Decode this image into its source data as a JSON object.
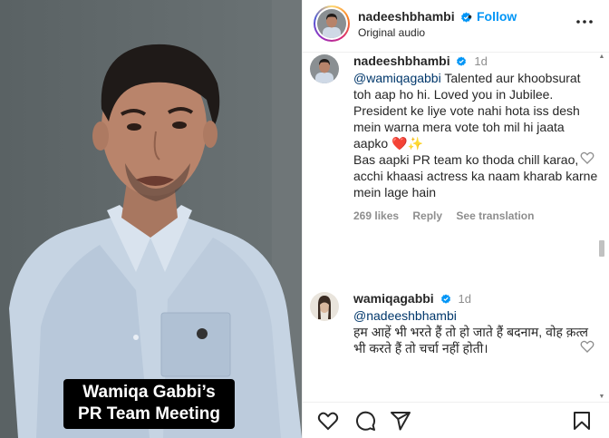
{
  "video": {
    "caption_line1": "Wamiqa Gabbi’s",
    "caption_line2": "PR Team Meeting"
  },
  "header": {
    "username": "nadeeshbhambi",
    "separator": "•",
    "follow_label": "Follow",
    "audio_label": "Original audio"
  },
  "comments": [
    {
      "username": "nadeeshbhambi",
      "time": "1d",
      "mention": "@wamiqagabbi",
      "text": "Talented aur khoobsurat toh aap ho hi. Loved you in Jubilee. President ke liye vote nahi hota iss desh mein warna mera vote toh mil hi jaata aapko",
      "emoji": "❤️✨",
      "text2": "Bas aapki PR team ko thoda chill karao, acchi khaasi actress ka naam kharab karne mein lage hain",
      "likes": "269 likes",
      "reply_label": "Reply",
      "translate_label": "See translation"
    },
    {
      "username": "wamiqagabbi",
      "time": "1d",
      "mention": "@nadeeshbhambi",
      "text": "हम आहें भी भरते हैं तो हो जाते हैं बदनाम, वोह क़त्ल भी करते हैं तो चर्चा नहीं होती।"
    }
  ],
  "colors": {
    "link_blue": "#0095f6",
    "mention_blue": "#00376b",
    "muted": "#8e8e8e",
    "verified": "#0095f6"
  },
  "icons": [
    "verified-badge-icon",
    "more-options-icon",
    "heart-icon",
    "comment-icon",
    "share-icon",
    "bookmark-icon"
  ]
}
